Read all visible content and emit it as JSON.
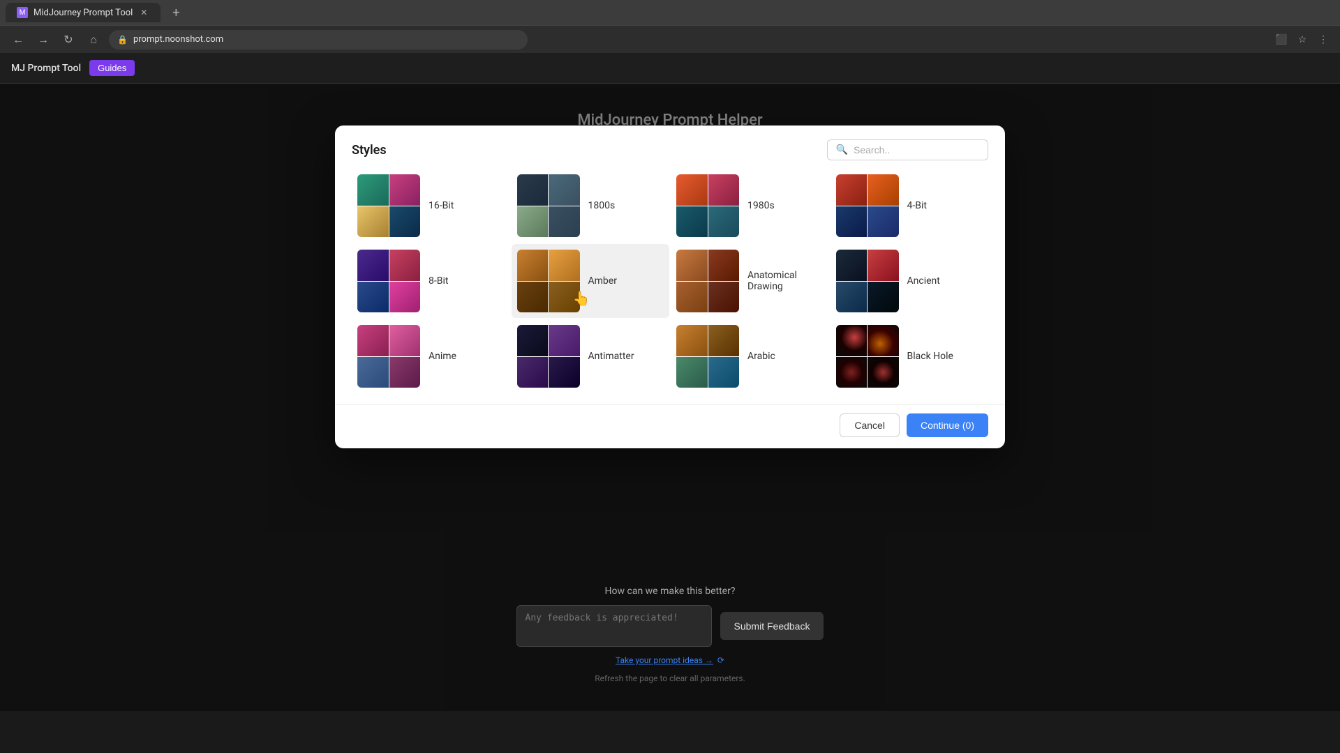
{
  "browser": {
    "tab_title": "MidJourney Prompt Tool",
    "url": "prompt.noonshot.com",
    "new_tab_label": "+"
  },
  "app": {
    "logo": "MJ Prompt Tool",
    "nav_guides": "Guides"
  },
  "page": {
    "title": "MidJourney Prompt Helper"
  },
  "modal": {
    "title": "Styles",
    "search_placeholder": "Search..",
    "styles": [
      {
        "id": "16bit",
        "label": "16-Bit",
        "colors": [
          "#2d9b7a",
          "#c84080",
          "#1a4a6a",
          "#e8c56a"
        ]
      },
      {
        "id": "1800s",
        "label": "1800s",
        "colors": [
          "#2a3a4a",
          "#4a6a7a",
          "#8aaa8a",
          "#3a5060"
        ]
      },
      {
        "id": "1980s",
        "label": "1980s",
        "colors": [
          "#e85a30",
          "#1a5a6a",
          "#c84060",
          "#2a6a7a"
        ]
      },
      {
        "id": "4bit",
        "label": "4-Bit",
        "colors": [
          "#c84030",
          "#e86020",
          "#1a3a6a",
          "#2a4a8a"
        ]
      },
      {
        "id": "8bit",
        "label": "8-Bit",
        "colors": [
          "#4a2a8a",
          "#c84060",
          "#2a4a8a",
          "#e040a0"
        ]
      },
      {
        "id": "amber",
        "label": "Amber",
        "colors": [
          "#c88030",
          "#e8a040",
          "#6a4010",
          "#8a6020"
        ]
      },
      {
        "id": "anatomical",
        "label": "Anatomical Drawing",
        "colors": [
          "#c87a40",
          "#8a3a20",
          "#6a3020",
          "#a86030"
        ]
      },
      {
        "id": "ancient",
        "label": "Ancient",
        "colors": [
          "#1a2a3a",
          "#c84040",
          "#2a4a6a",
          "#0a1a2a"
        ]
      },
      {
        "id": "anime",
        "label": "Anime",
        "colors": [
          "#c84080",
          "#4a6a9a",
          "#8a3a6a",
          "#e060a0"
        ]
      },
      {
        "id": "antimatter",
        "label": "Antimatter",
        "colors": [
          "#1a1a3a",
          "#6a3a8a",
          "#2a1a4a",
          "#4a2a6a"
        ]
      },
      {
        "id": "arabic",
        "label": "Arabic",
        "colors": [
          "#c88030",
          "#4a8a6a",
          "#2a6a8a",
          "#8a6020"
        ]
      },
      {
        "id": "blackhole",
        "label": "Black Hole",
        "colors": [
          "#1a1a1a",
          "#c84040",
          "#0a0a0a",
          "#2a0a0a"
        ]
      }
    ],
    "cancel_label": "Cancel",
    "continue_label": "Continue (0)"
  },
  "feedback": {
    "title": "How can we make this better?",
    "placeholder": "Any feedback is appreciated!",
    "submit_label": "Submit Feedback",
    "update_link": "Take your prompt ideas →",
    "refresh_text": "Refresh the page to clear all parameters."
  },
  "hovered_item": "amber"
}
